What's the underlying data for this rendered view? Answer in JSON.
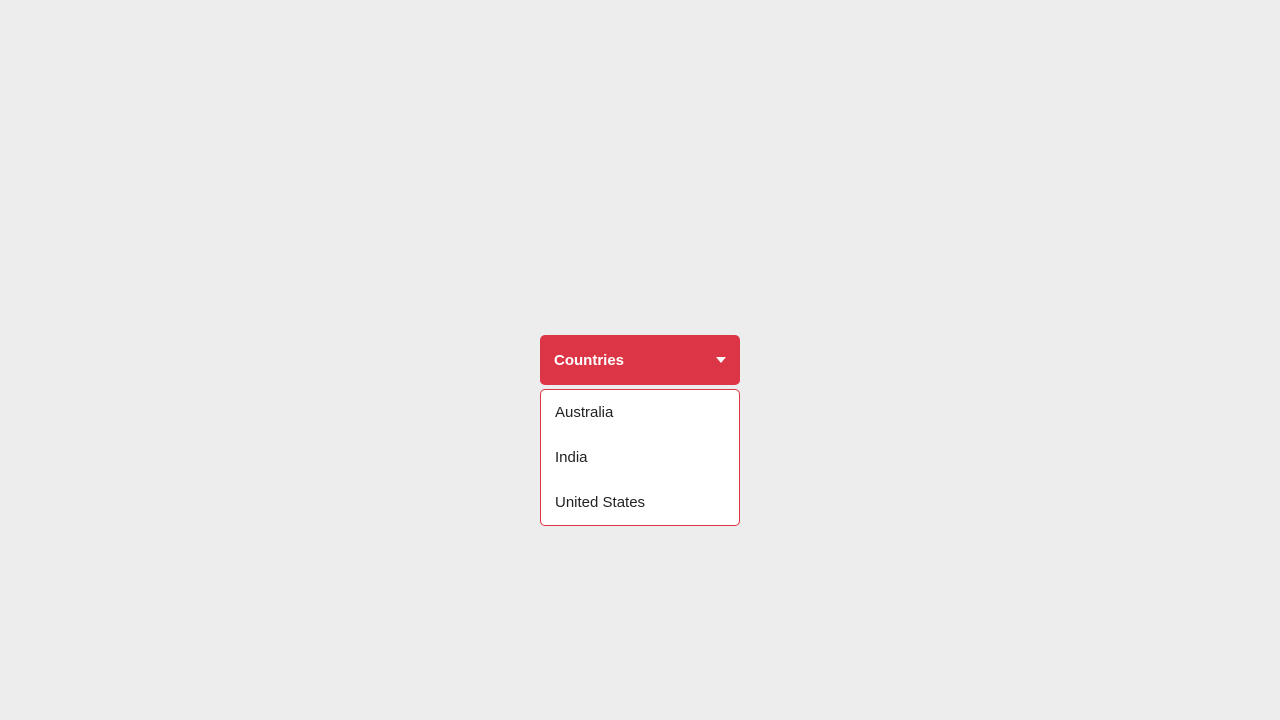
{
  "dropdown": {
    "label": "Countries",
    "items": [
      "Australia",
      "India",
      "United States"
    ]
  }
}
